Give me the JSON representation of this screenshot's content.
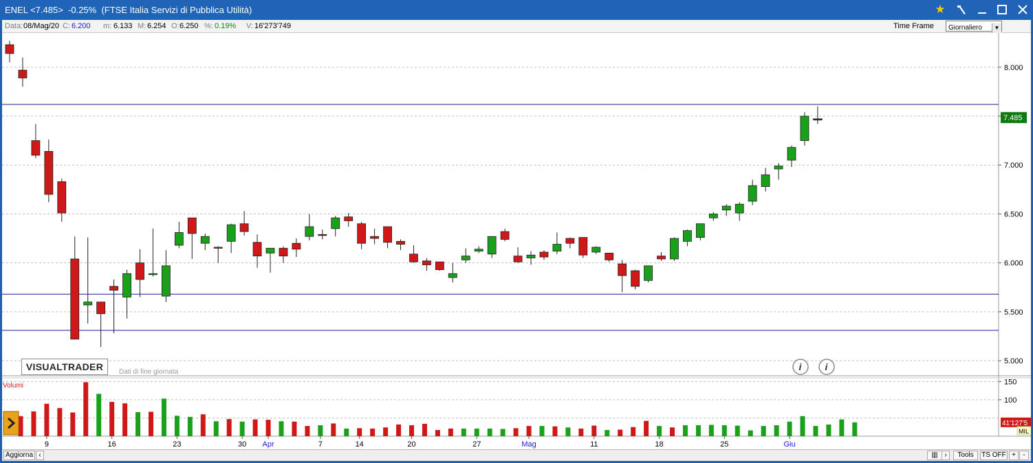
{
  "window": {
    "title": "ENEL <7.485>  -0.25%  (FTSE Italia Servizi di Pubblica Utilità)"
  },
  "infobar": {
    "date_label": "Data:",
    "date_value": "08/Mag/20",
    "close_label": "C:",
    "close_value": "6.200",
    "min_label": "m:",
    "min_value": "6.133",
    "max_label": "M:",
    "max_value": "6.254",
    "open_label": "O:",
    "open_value": "6.250",
    "pct_label": "%:",
    "pct_value": "0.19%",
    "vol_label": "V:",
    "vol_value": "16'273'749",
    "timeframe_label": "Time Frame",
    "timeframe_value": "Giornaliero"
  },
  "branding": {
    "logo": "VISUALTRADER",
    "subtitle": "Dati di fine giornata"
  },
  "statusbar": {
    "update": "Aggiorna",
    "tools": "Tools",
    "ts": "TS OFF",
    "plus": "+",
    "minus": "-"
  },
  "colors": {
    "up": "#1aa01a",
    "down": "#d01818",
    "outline": "#202020",
    "hline": "#1c1c9a",
    "last_price_bg": "#0e7a0e"
  },
  "chart_data": {
    "type": "candlestick",
    "last_price": "7.485",
    "ylim": [
      4.86,
      8.35
    ],
    "yticks": [
      "8.000",
      "7.500",
      "7.000",
      "6.500",
      "6.000",
      "5.500",
      "5.000"
    ],
    "yticks_values": [
      8.0,
      7.5,
      7.0,
      6.5,
      6.0,
      5.5,
      5.0
    ],
    "horizontal_lines": [
      7.62,
      5.68,
      5.31
    ],
    "x_labels": [
      {
        "i": 2,
        "text": "9",
        "month": false
      },
      {
        "i": 7,
        "text": "16",
        "month": false
      },
      {
        "i": 12,
        "text": "23",
        "month": false
      },
      {
        "i": 17,
        "text": "30",
        "month": false
      },
      {
        "i": 19,
        "text": "Apr",
        "month": true
      },
      {
        "i": 23,
        "text": "7",
        "month": false
      },
      {
        "i": 26,
        "text": "14",
        "month": false
      },
      {
        "i": 30,
        "text": "20",
        "month": false
      },
      {
        "i": 35,
        "text": "27",
        "month": false
      },
      {
        "i": 39,
        "text": "Mag",
        "month": true
      },
      {
        "i": 44,
        "text": "11",
        "month": false
      },
      {
        "i": 49,
        "text": "18",
        "month": false
      },
      {
        "i": 54,
        "text": "25",
        "month": false
      },
      {
        "i": 59,
        "text": "Giu",
        "month": true
      }
    ],
    "candles": [
      {
        "o": 8.23,
        "h": 8.27,
        "l": 8.05,
        "c": 8.14
      },
      {
        "o": 7.97,
        "h": 8.1,
        "l": 7.8,
        "c": 7.89
      },
      {
        "o": 7.25,
        "h": 7.42,
        "l": 7.07,
        "c": 7.1
      },
      {
        "o": 7.14,
        "h": 7.26,
        "l": 6.62,
        "c": 6.7
      },
      {
        "o": 6.83,
        "h": 6.86,
        "l": 6.42,
        "c": 6.51
      },
      {
        "o": 6.04,
        "h": 6.27,
        "l": 5.22,
        "c": 5.22
      },
      {
        "o": 5.57,
        "h": 6.26,
        "l": 5.38,
        "c": 5.6
      },
      {
        "o": 5.6,
        "h": 5.6,
        "l": 5.14,
        "c": 5.48
      },
      {
        "o": 5.76,
        "h": 5.83,
        "l": 5.28,
        "c": 5.72
      },
      {
        "o": 5.65,
        "h": 5.93,
        "l": 5.43,
        "c": 5.89
      },
      {
        "o": 6.0,
        "h": 6.14,
        "l": 5.65,
        "c": 5.83
      },
      {
        "o": 5.88,
        "h": 6.35,
        "l": 5.86,
        "c": 5.89
      },
      {
        "o": 5.66,
        "h": 6.13,
        "l": 5.6,
        "c": 5.97
      },
      {
        "o": 6.18,
        "h": 6.42,
        "l": 6.15,
        "c": 6.31
      },
      {
        "o": 6.46,
        "h": 6.46,
        "l": 6.04,
        "c": 6.3
      },
      {
        "o": 6.2,
        "h": 6.3,
        "l": 6.13,
        "c": 6.27
      },
      {
        "o": 6.16,
        "h": 6.17,
        "l": 6.0,
        "c": 6.15
      },
      {
        "o": 6.22,
        "h": 6.4,
        "l": 6.1,
        "c": 6.39
      },
      {
        "o": 6.4,
        "h": 6.53,
        "l": 6.28,
        "c": 6.32
      },
      {
        "o": 6.21,
        "h": 6.29,
        "l": 5.95,
        "c": 6.07
      },
      {
        "o": 6.1,
        "h": 6.13,
        "l": 5.9,
        "c": 6.15
      },
      {
        "o": 6.15,
        "h": 6.17,
        "l": 6.0,
        "c": 6.07
      },
      {
        "o": 6.2,
        "h": 6.25,
        "l": 6.06,
        "c": 6.14
      },
      {
        "o": 6.27,
        "h": 6.5,
        "l": 6.23,
        "c": 6.37
      },
      {
        "o": 6.29,
        "h": 6.34,
        "l": 6.24,
        "c": 6.28
      },
      {
        "o": 6.35,
        "h": 6.48,
        "l": 6.27,
        "c": 6.46
      },
      {
        "o": 6.47,
        "h": 6.51,
        "l": 6.37,
        "c": 6.43
      },
      {
        "o": 6.4,
        "h": 6.42,
        "l": 6.14,
        "c": 6.2
      },
      {
        "o": 6.27,
        "h": 6.35,
        "l": 6.19,
        "c": 6.25
      },
      {
        "o": 6.37,
        "h": 6.37,
        "l": 6.15,
        "c": 6.21
      },
      {
        "o": 6.22,
        "h": 6.24,
        "l": 6.13,
        "c": 6.19
      },
      {
        "o": 6.09,
        "h": 6.18,
        "l": 6.0,
        "c": 6.01
      },
      {
        "o": 6.02,
        "h": 6.05,
        "l": 5.92,
        "c": 5.98
      },
      {
        "o": 6.01,
        "h": 6.01,
        "l": 5.92,
        "c": 5.93
      },
      {
        "o": 5.85,
        "h": 6.0,
        "l": 5.8,
        "c": 5.89
      },
      {
        "o": 6.03,
        "h": 6.15,
        "l": 6.0,
        "c": 6.07
      },
      {
        "o": 6.12,
        "h": 6.17,
        "l": 6.1,
        "c": 6.14
      },
      {
        "o": 6.09,
        "h": 6.27,
        "l": 6.05,
        "c": 6.27
      },
      {
        "o": 6.32,
        "h": 6.35,
        "l": 6.22,
        "c": 6.24
      },
      {
        "o": 6.07,
        "h": 6.16,
        "l": 6.0,
        "c": 6.01
      },
      {
        "o": 6.05,
        "h": 6.12,
        "l": 5.98,
        "c": 6.08
      },
      {
        "o": 6.11,
        "h": 6.13,
        "l": 6.03,
        "c": 6.06
      },
      {
        "o": 6.12,
        "h": 6.31,
        "l": 6.09,
        "c": 6.19
      },
      {
        "o": 6.25,
        "h": 6.26,
        "l": 6.15,
        "c": 6.2
      },
      {
        "o": 6.26,
        "h": 6.26,
        "l": 6.05,
        "c": 6.08
      },
      {
        "o": 6.11,
        "h": 6.17,
        "l": 6.09,
        "c": 6.16
      },
      {
        "o": 6.1,
        "h": 6.1,
        "l": 6.01,
        "c": 6.03
      },
      {
        "o": 5.99,
        "h": 6.03,
        "l": 5.7,
        "c": 5.87
      },
      {
        "o": 5.92,
        "h": 5.93,
        "l": 5.73,
        "c": 5.76
      },
      {
        "o": 5.82,
        "h": 5.97,
        "l": 5.8,
        "c": 5.97
      },
      {
        "o": 6.07,
        "h": 6.11,
        "l": 6.02,
        "c": 6.04
      },
      {
        "o": 6.04,
        "h": 6.26,
        "l": 6.02,
        "c": 6.25
      },
      {
        "o": 6.22,
        "h": 6.34,
        "l": 6.17,
        "c": 6.33
      },
      {
        "o": 6.26,
        "h": 6.4,
        "l": 6.23,
        "c": 6.4
      },
      {
        "o": 6.46,
        "h": 6.52,
        "l": 6.43,
        "c": 6.5
      },
      {
        "o": 6.54,
        "h": 6.6,
        "l": 6.48,
        "c": 6.58
      },
      {
        "o": 6.51,
        "h": 6.62,
        "l": 6.43,
        "c": 6.6
      },
      {
        "o": 6.63,
        "h": 6.85,
        "l": 6.59,
        "c": 6.79
      },
      {
        "o": 6.78,
        "h": 6.97,
        "l": 6.73,
        "c": 6.9
      },
      {
        "o": 6.96,
        "h": 7.02,
        "l": 6.85,
        "c": 6.99
      },
      {
        "o": 7.05,
        "h": 7.2,
        "l": 6.98,
        "c": 7.18
      },
      {
        "o": 7.25,
        "h": 7.54,
        "l": 7.2,
        "c": 7.5
      },
      {
        "o": 7.47,
        "h": 7.6,
        "l": 7.42,
        "c": 7.47
      }
    ],
    "volume": {
      "label": "Volumi",
      "yticks": [
        "150",
        "100"
      ],
      "yticks_values": [
        150,
        100
      ],
      "ymax": 160,
      "last_value": "41'127'5",
      "unit": "MIL",
      "values": [
        55,
        68,
        89,
        77,
        65,
        148,
        116,
        94,
        90,
        66,
        67,
        103,
        56,
        53,
        60,
        41,
        47,
        40,
        46,
        45,
        41,
        40,
        28,
        30,
        35,
        21,
        22,
        21,
        24,
        32,
        30,
        34,
        17,
        21,
        21,
        21,
        21,
        20,
        22,
        28,
        28,
        27,
        24,
        21,
        29,
        17,
        18,
        25,
        42,
        28,
        24,
        30,
        30,
        31,
        30,
        29,
        16,
        28,
        30,
        40,
        55,
        28,
        32,
        46,
        38
      ]
    }
  }
}
